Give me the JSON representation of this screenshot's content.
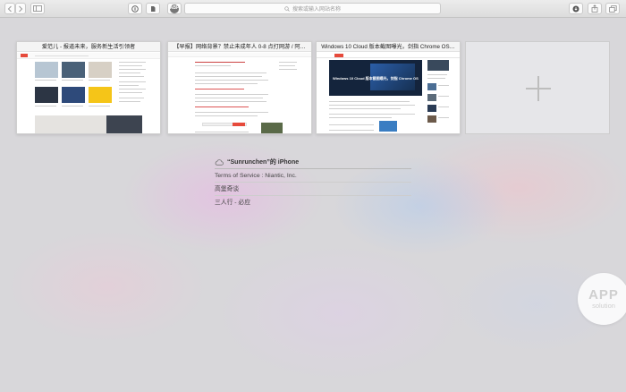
{
  "toolbar": {
    "search_placeholder": "搜索或输入网站名称",
    "buttons": {
      "back": "back-icon",
      "forward": "forward-icon",
      "sidebar": "sidebar-icon",
      "reader": "reader-icon",
      "extension": "evernote-icon",
      "abp": "ABP",
      "download": "download-icon",
      "share": "share-icon",
      "tabs": "tabs-icon"
    }
  },
  "tabs": [
    {
      "title": "爱范儿 - 报道未来，服务新生活引领者"
    },
    {
      "title": "【早报】网络背景？禁止未成年人 0-8 点打网游 / 阿…"
    },
    {
      "title": "Windows 10 Cloud 版本截图曝光，剑指 Chrome OS…"
    }
  ],
  "tab3_banner": "Windows 10 Cloud 版本截图曝光，剑指 Chrome OS",
  "cloud_tabs": {
    "device": "“Sunrunchen”的 iPhone",
    "items": [
      "Terms of Service : Niantic, Inc.",
      "高堡奇谈",
      "三人行 - 必应"
    ]
  },
  "watermark": {
    "line1": "APP",
    "line2": "solution"
  },
  "colors": {
    "accent_red": "#e64a3b",
    "dark": "#1f2a3a",
    "bg": "#d8d7da"
  }
}
